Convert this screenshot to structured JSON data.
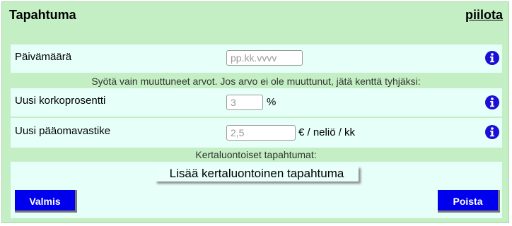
{
  "header": {
    "title": "Tapahtuma",
    "hide_link": "piilota"
  },
  "date_row": {
    "label": "Päivämäärä",
    "placeholder": "pp.kk.vvvv",
    "value": ""
  },
  "note_changed": "Syötä vain muuttuneet arvot. Jos arvo ei ole muuttunut, jätä kenttä tyhjäksi:",
  "interest_row": {
    "label": "Uusi korkoprosentti",
    "placeholder": "3",
    "unit": "%"
  },
  "capital_row": {
    "label": "Uusi pääomavastike",
    "placeholder": "2,5",
    "unit": "€ / neliö / kk"
  },
  "one_time_section": {
    "label": "Kertaluontoiset tapahtumat:",
    "add_button": "Lisää kertaluontoinen tapahtuma"
  },
  "footer": {
    "done_button": "Valmis",
    "delete_button": "Poista"
  },
  "colors": {
    "panel_background": "#c4efc4",
    "row_background": "#e6fff8",
    "button_blue": "#0000ee",
    "info_icon_blue": "#1a0fd6"
  },
  "icons": {
    "info": "info-icon"
  }
}
